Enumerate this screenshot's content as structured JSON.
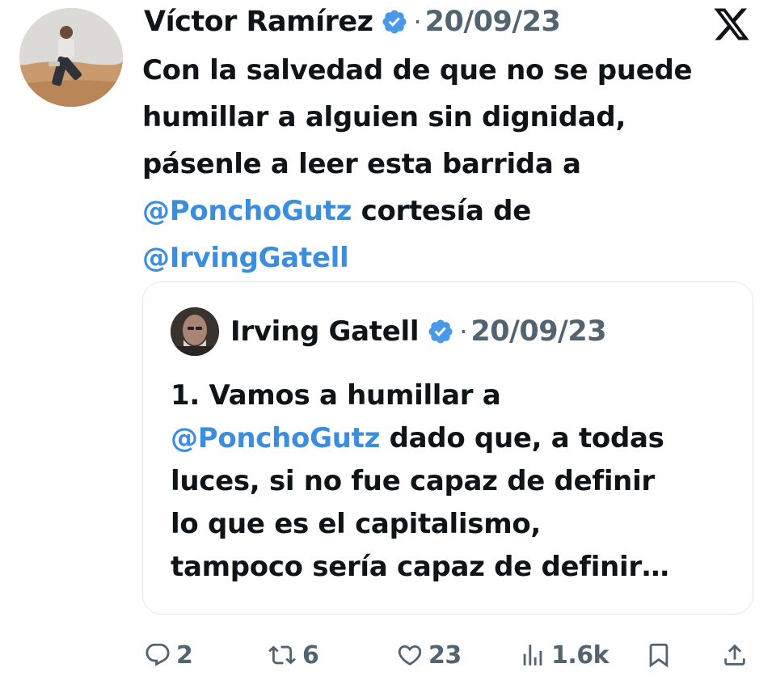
{
  "tweet": {
    "author_name": "Víctor Ramírez",
    "separator": "·",
    "date": "20/09/23",
    "text_lines": [
      [
        {
          "t": "Con la salvedad de que no se puede",
          "m": false
        }
      ],
      [
        {
          "t": "humillar a alguien sin dignidad,",
          "m": false
        }
      ],
      [
        {
          "t": "pásenle a leer esta barrida a",
          "m": false
        }
      ],
      [
        {
          "t": "@PonchoGutz",
          "m": true
        },
        {
          "t": " cortesía de",
          "m": false
        }
      ],
      [
        {
          "t": "@IrvingGatell",
          "m": true
        }
      ]
    ]
  },
  "quoted_tweet": {
    "author_name": "Irving Gatell",
    "separator": "·",
    "date": "20/09/23",
    "text_lines": [
      [
        {
          "t": "1. Vamos a humillar a",
          "m": false
        }
      ],
      [
        {
          "t": "@PonchoGutz",
          "m": true
        },
        {
          "t": " dado que, a todas",
          "m": false
        }
      ],
      [
        {
          "t": "luces, si no fue capaz de definir",
          "m": false
        }
      ],
      [
        {
          "t": "lo que es el capitalismo,",
          "m": false
        }
      ],
      [
        {
          "t": "tampoco sería capaz de definir…",
          "m": false
        }
      ]
    ]
  },
  "actions": {
    "replies": "2",
    "retweets": "6",
    "likes": "23",
    "views": "1.6k"
  },
  "icons": {
    "verified": "verified-badge-icon",
    "brand": "x-logo-icon",
    "reply": "reply-icon",
    "retweet": "retweet-icon",
    "like": "heart-icon",
    "views": "views-icon",
    "bookmark": "bookmark-icon",
    "share": "share-icon"
  },
  "colors": {
    "mention": "#3b8ede",
    "verified": "#4a99e9",
    "muted": "#536471",
    "text": "#0f1419",
    "border": "#e1e8ed"
  }
}
